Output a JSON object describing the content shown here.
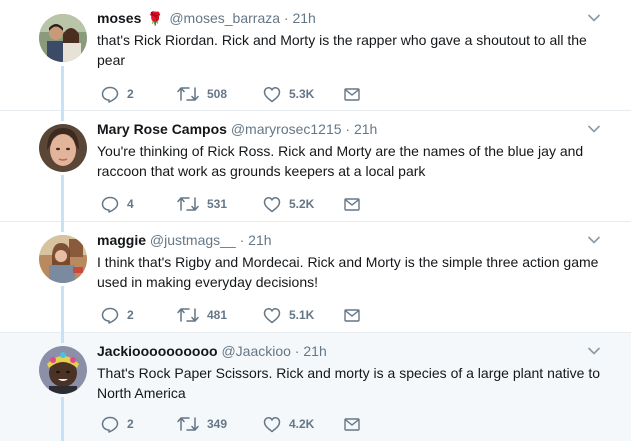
{
  "colors": {
    "accent": "#1da1f2",
    "muted": "#657786",
    "thread_line": "#c4e3f7",
    "highlight_bg": "#f5f8fa"
  },
  "tweets": [
    {
      "name": "moses",
      "emoji": "🌹",
      "handle": "@moses_barraza",
      "sep": " · ",
      "time": "21h",
      "text": "that's Rick Riordan. Rick and Morty is the rapper who gave a shoutout to all the pear",
      "replies": "2",
      "retweets": "508",
      "likes": "5.3K",
      "icons": [
        "reply-icon",
        "retweet-icon",
        "like-icon",
        "message-icon",
        "chevron-down-icon"
      ]
    },
    {
      "name": "Mary Rose Campos",
      "handle": "@maryrosec1215",
      "sep": " · ",
      "time": "21h",
      "text": "You're thinking of Rick Ross. Rick and Morty are the names of the blue jay and raccoon that work as grounds keepers at a local park",
      "replies": "4",
      "retweets": "531",
      "likes": "5.2K"
    },
    {
      "name": "maggie",
      "handle": "@justmags__",
      "sep": " · ",
      "time": "21h",
      "text": "I think that's Rigby and Mordecai. Rick and Morty is the simple three action game used in making everyday decisions!",
      "replies": "2",
      "retweets": "481",
      "likes": "5.1K"
    },
    {
      "name": "Jackioooooooooo",
      "handle": "@Jaackioo",
      "sep": " · ",
      "time": "21h",
      "text": "That's Rock Paper Scissors. Rick and morty is a species of a large plant native to North America",
      "replies": "2",
      "retweets": "349",
      "likes": "4.2K"
    }
  ]
}
